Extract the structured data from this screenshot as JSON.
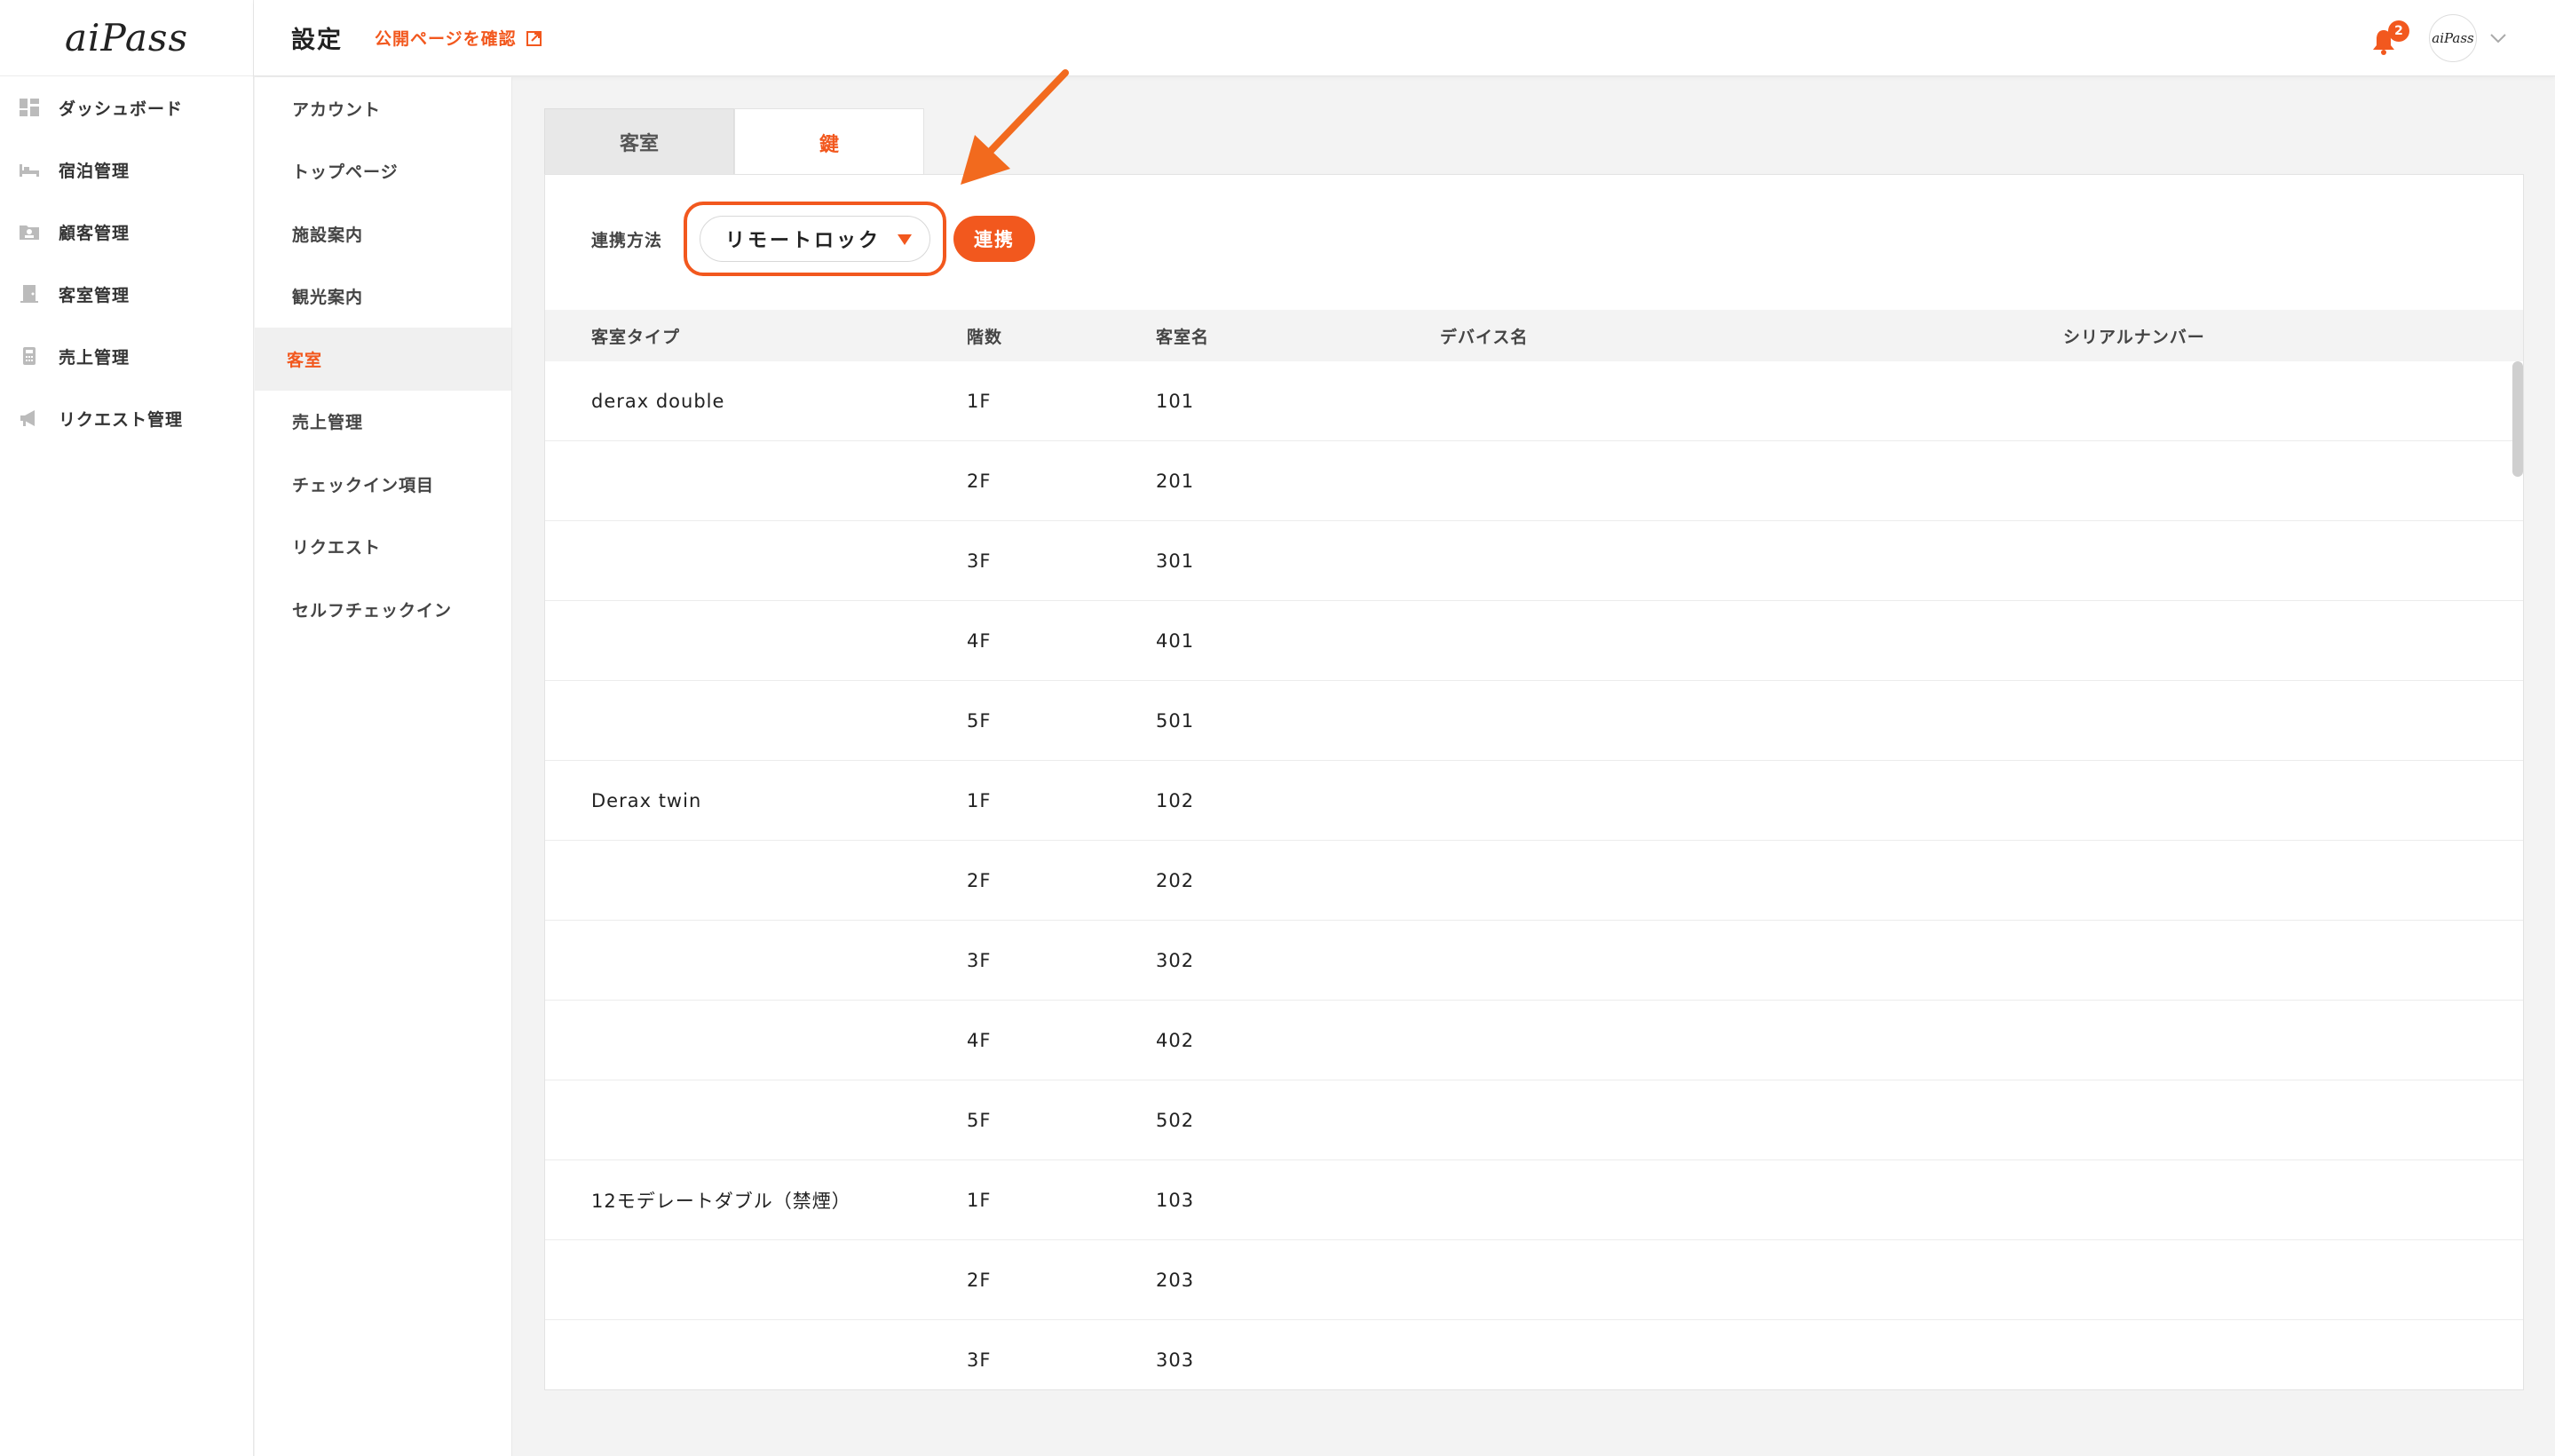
{
  "brand": {
    "logo_text": "aiPass",
    "accent_color": "#f2581e"
  },
  "sidebar": {
    "items": [
      {
        "label": "ダッシュボード",
        "icon": "dashboard-icon"
      },
      {
        "label": "宿泊管理",
        "icon": "bed-icon"
      },
      {
        "label": "顧客管理",
        "icon": "customer-folder-icon"
      },
      {
        "label": "客室管理",
        "icon": "room-door-icon"
      },
      {
        "label": "売上管理",
        "icon": "calculator-icon"
      },
      {
        "label": "リクエスト管理",
        "icon": "megaphone-icon"
      }
    ]
  },
  "header": {
    "title": "設定",
    "public_link": "公開ページを確認",
    "notification_count": "2",
    "avatar_text": "aiPass"
  },
  "subnav": {
    "items": [
      {
        "label": "アカウント",
        "active": false
      },
      {
        "label": "トップページ",
        "active": false
      },
      {
        "label": "施設案内",
        "active": false
      },
      {
        "label": "観光案内",
        "active": false
      },
      {
        "label": "客室",
        "active": true
      },
      {
        "label": "売上管理",
        "active": false
      },
      {
        "label": "チェックイン項目",
        "active": false
      },
      {
        "label": "リクエスト",
        "active": false
      },
      {
        "label": "セルフチェックイン",
        "active": false
      }
    ]
  },
  "tabs": [
    {
      "label": "客室",
      "active": false
    },
    {
      "label": "鍵",
      "active": true
    }
  ],
  "form": {
    "label": "連携方法",
    "select_value": "リモートロック",
    "button_label": "連携"
  },
  "table": {
    "headers": [
      "客室タイプ",
      "階数",
      "客室名",
      "デバイス名",
      "シリアルナンバー"
    ],
    "rows": [
      {
        "type": "derax double",
        "floor": "1F",
        "room": "101"
      },
      {
        "type": "",
        "floor": "2F",
        "room": "201"
      },
      {
        "type": "",
        "floor": "3F",
        "room": "301"
      },
      {
        "type": "",
        "floor": "4F",
        "room": "401"
      },
      {
        "type": "",
        "floor": "5F",
        "room": "501"
      },
      {
        "type": "Derax twin",
        "floor": "1F",
        "room": "102"
      },
      {
        "type": "",
        "floor": "2F",
        "room": "202"
      },
      {
        "type": "",
        "floor": "3F",
        "room": "302"
      },
      {
        "type": "",
        "floor": "4F",
        "room": "402"
      },
      {
        "type": "",
        "floor": "5F",
        "room": "502"
      },
      {
        "type": "12モデレートダブル（禁煙）",
        "floor": "1F",
        "room": "103"
      },
      {
        "type": "",
        "floor": "2F",
        "room": "203"
      },
      {
        "type": "",
        "floor": "3F",
        "room": "303"
      }
    ]
  }
}
